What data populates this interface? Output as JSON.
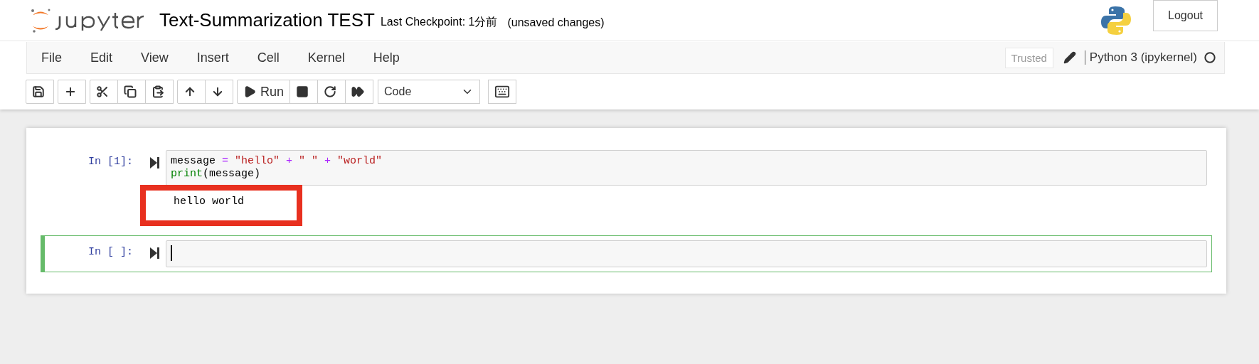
{
  "header": {
    "notebook_title": "Text-Summarization TEST",
    "checkpoint": "Last Checkpoint: 1分前",
    "save_status": "(unsaved changes)",
    "logout": "Logout"
  },
  "menu": [
    "File",
    "Edit",
    "View",
    "Insert",
    "Cell",
    "Kernel",
    "Help"
  ],
  "status": {
    "trusted": "Trusted",
    "kernel": "Python 3 (ipykernel)",
    "busy": false
  },
  "run_label": "Run",
  "cell_type": "Code",
  "cells": [
    {
      "prompt": "In [1]:",
      "selected": false,
      "lines": [
        [
          {
            "kind": "name",
            "text": "message"
          },
          {
            "kind": "op",
            "text": " = "
          },
          {
            "kind": "string",
            "text": "\"hello\""
          },
          {
            "kind": "op",
            "text": " + "
          },
          {
            "kind": "string",
            "text": "\" \""
          },
          {
            "kind": "op",
            "text": " + "
          },
          {
            "kind": "string",
            "text": "\"world\""
          }
        ],
        [
          {
            "kind": "builtin",
            "text": "print"
          },
          {
            "kind": "name",
            "text": "(message)"
          }
        ]
      ],
      "outputs": [
        {
          "text": "hello world",
          "highlighted": true
        }
      ]
    },
    {
      "prompt": "In [ ]:",
      "selected": true
    }
  ]
}
